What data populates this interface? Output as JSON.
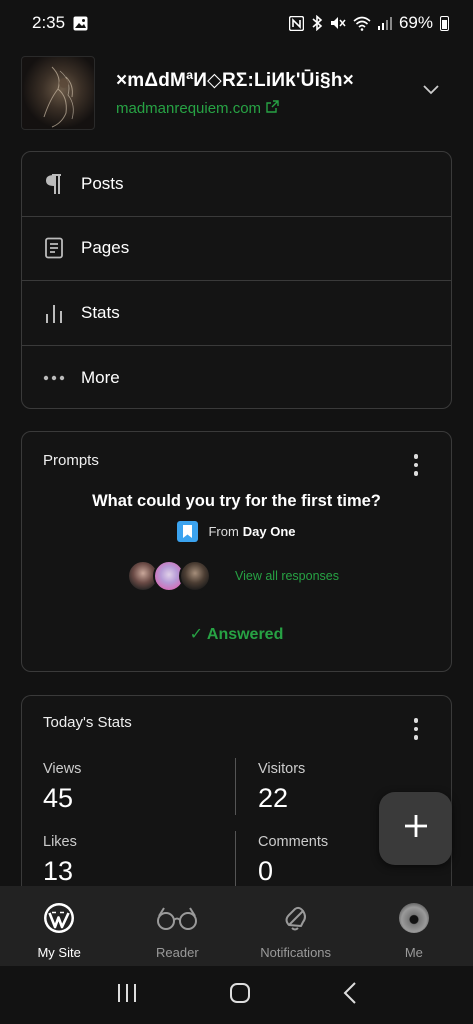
{
  "status_bar": {
    "time": "2:35",
    "battery": "69%"
  },
  "site": {
    "title": "×mΔdMªИ◇RΣ:LiИk'Ūi§h×",
    "url": "madmanrequiem.com"
  },
  "menu": {
    "items": [
      {
        "label": "Posts",
        "icon": "paragraph-icon"
      },
      {
        "label": "Pages",
        "icon": "page-icon"
      },
      {
        "label": "Stats",
        "icon": "stats-icon"
      },
      {
        "label": "More",
        "icon": "more-icon"
      }
    ]
  },
  "prompts": {
    "header": "Prompts",
    "question": "What could you try for the first time?",
    "source_prefix": "From",
    "source_name": "Day One",
    "view_responses": "View all responses",
    "answered": "✓ Answered"
  },
  "stats": {
    "header": "Today's Stats",
    "items": [
      {
        "label": "Views",
        "value": "45"
      },
      {
        "label": "Visitors",
        "value": "22"
      },
      {
        "label": "Likes",
        "value": "13"
      },
      {
        "label": "Comments",
        "value": "0"
      }
    ]
  },
  "tabs": [
    {
      "label": "My Site",
      "icon": "wordpress-icon",
      "active": true
    },
    {
      "label": "Reader",
      "icon": "glasses-icon",
      "active": false
    },
    {
      "label": "Notifications",
      "icon": "bell-icon",
      "active": false
    },
    {
      "label": "Me",
      "icon": "me-avatar",
      "active": false
    }
  ],
  "colors": {
    "accent_green": "#27a244",
    "background": "#121212",
    "day_one_blue": "#3ba3ef"
  }
}
